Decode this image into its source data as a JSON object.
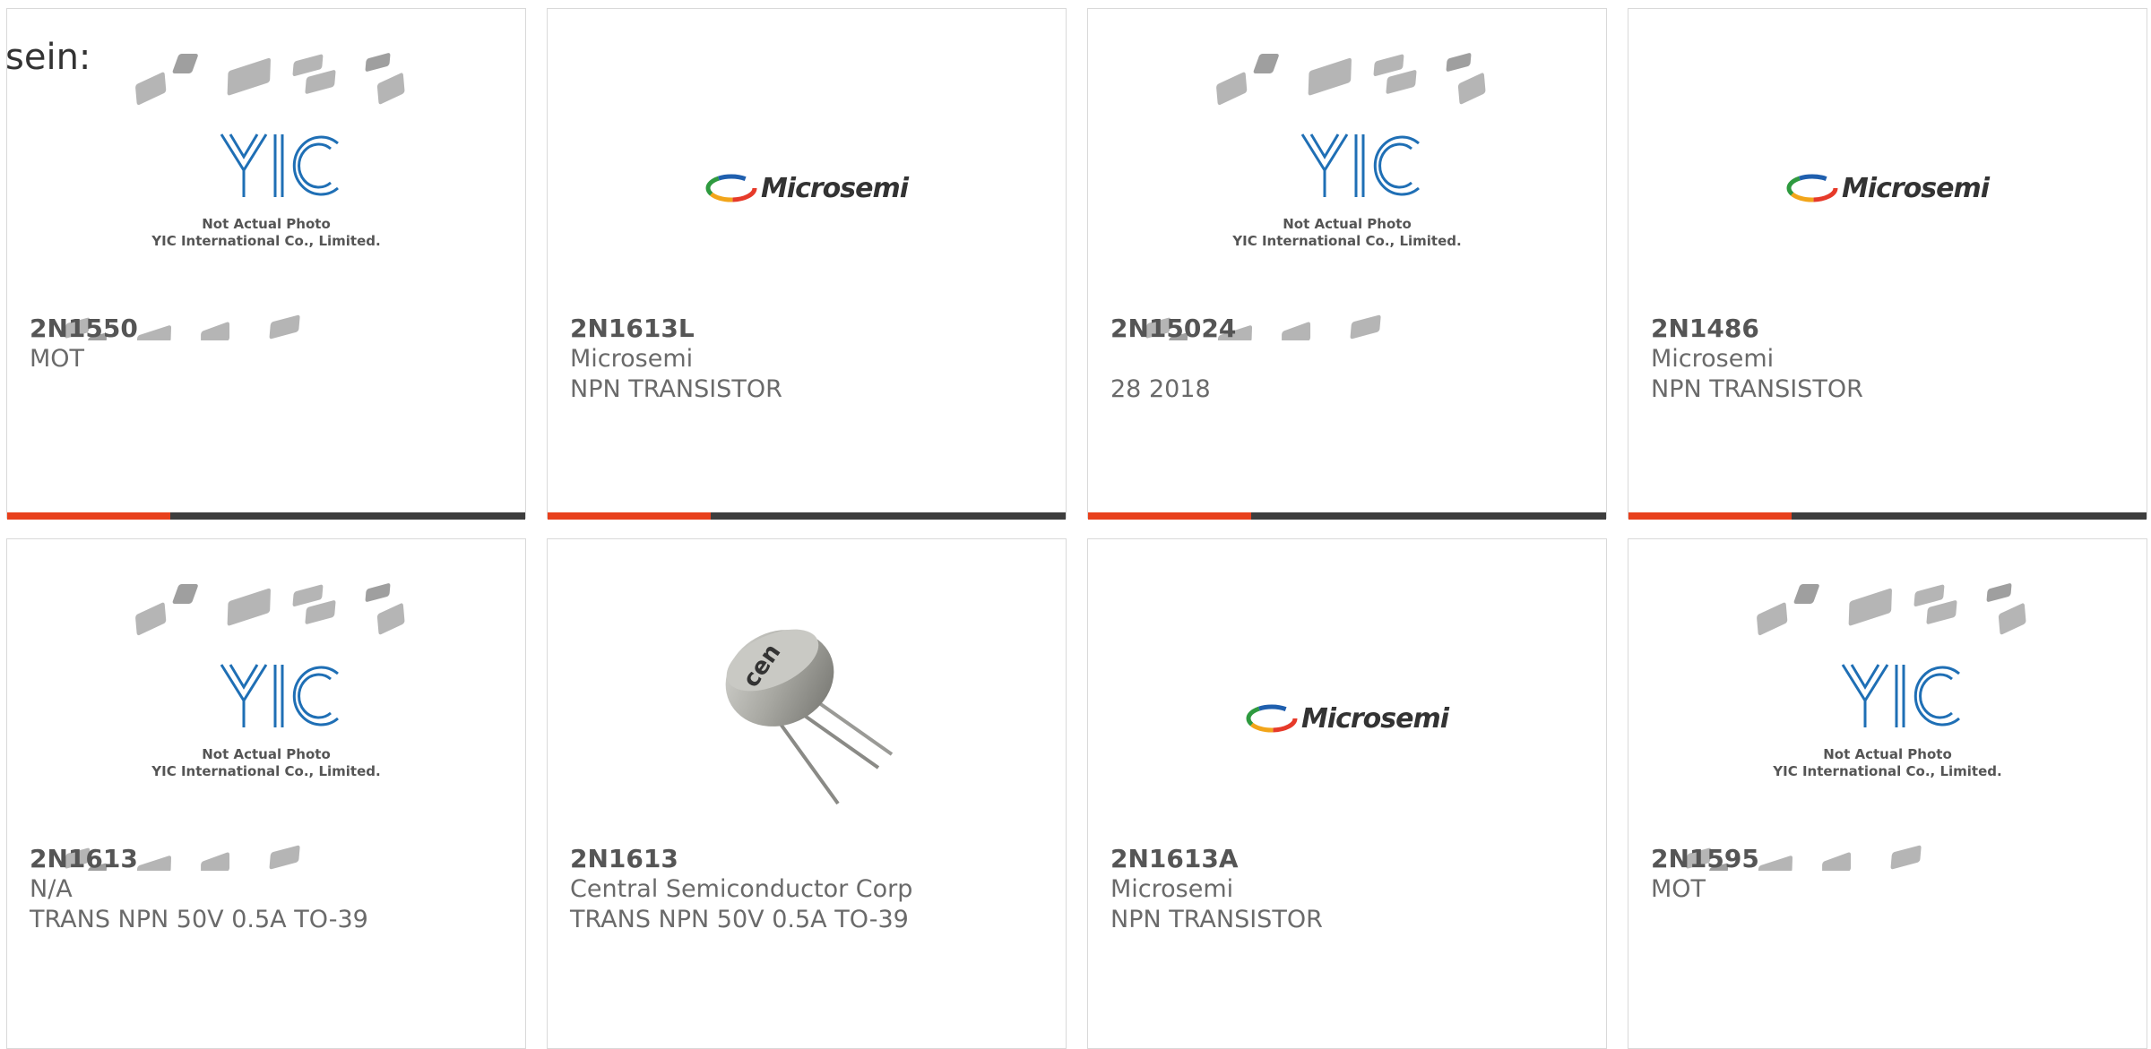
{
  "page": {
    "label": "sein:"
  },
  "colors": {
    "accent": "#e8401c",
    "bar_dark": "#3d3d3d",
    "yic_blue": "#1f6fb5"
  },
  "products": [
    {
      "part": "2N1550",
      "line1": "MOT",
      "line2": "",
      "image": "yic-placeholder"
    },
    {
      "part": "2N1613L",
      "line1": "Microsemi",
      "line2": "NPN TRANSISTOR",
      "image": "microsemi-logo"
    },
    {
      "part": "2N15024",
      "line1": "",
      "line2": "28 2018",
      "image": "yic-placeholder"
    },
    {
      "part": "2N1486",
      "line1": "Microsemi",
      "line2": "NPN TRANSISTOR",
      "image": "microsemi-logo"
    },
    {
      "part": "2N1613",
      "line1": "N/A",
      "line2": "TRANS NPN 50V 0.5A TO-39",
      "image": "yic-placeholder"
    },
    {
      "part": "2N1613",
      "line1": "Central Semiconductor Corp",
      "line2": "TRANS NPN 50V 0.5A TO-39",
      "image": "to39-transistor-photo"
    },
    {
      "part": "2N1613A",
      "line1": "Microsemi",
      "line2": "NPN TRANSISTOR",
      "image": "microsemi-logo"
    },
    {
      "part": "2N1595",
      "line1": "MOT",
      "line2": "",
      "image": "yic-placeholder"
    }
  ],
  "images": {
    "yic_placeholder": {
      "logo": "YIC",
      "caption_line1": "Not Actual Photo",
      "caption_line2": "YIC International Co., Limited."
    },
    "microsemi_logo": {
      "wordmark": "Microsemi"
    },
    "to39": {
      "marking": "cen"
    }
  }
}
